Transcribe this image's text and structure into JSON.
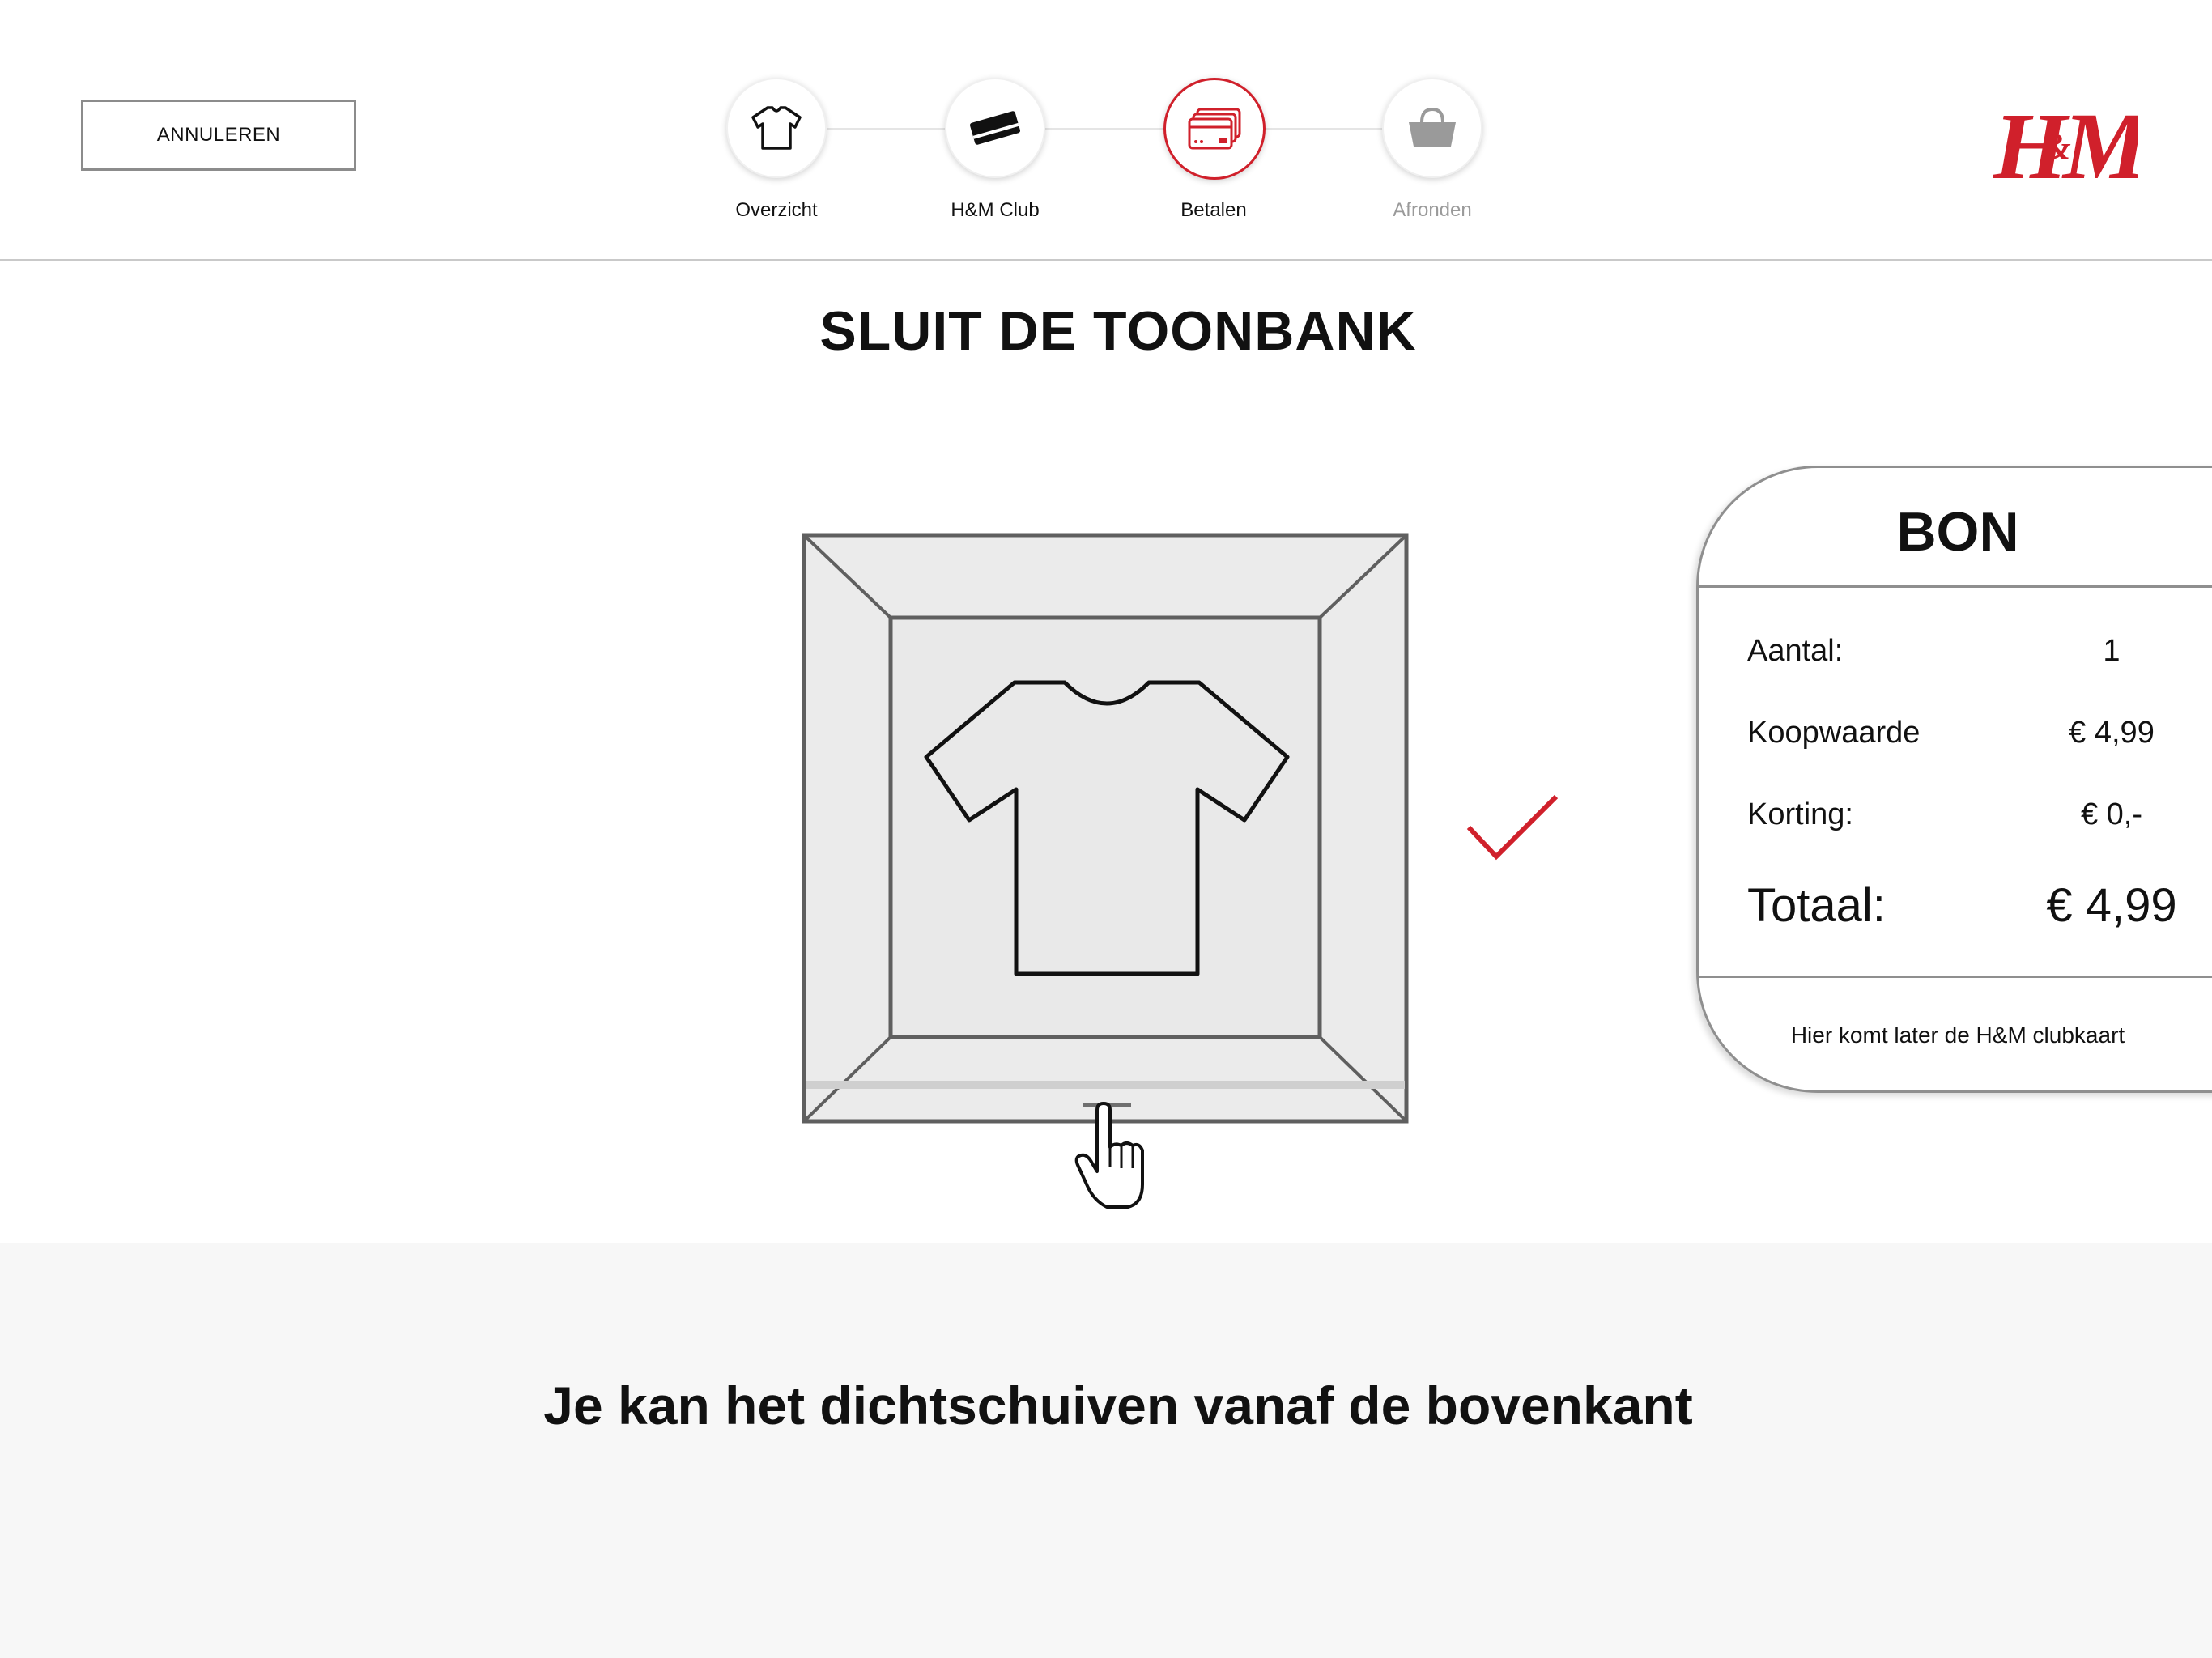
{
  "header": {
    "cancel_label": "ANNULEREN",
    "brand": "H&M",
    "brand_color": "#d0202b"
  },
  "stepper": {
    "steps": [
      {
        "label": "Overzicht",
        "icon": "tshirt-icon",
        "state": "done"
      },
      {
        "label": "H&M Club",
        "icon": "card-icon",
        "state": "done"
      },
      {
        "label": "Betalen",
        "icon": "payment-cards-icon",
        "state": "active"
      },
      {
        "label": "Afronden",
        "icon": "basket-icon",
        "state": "upcoming"
      }
    ],
    "active_color": "#d0202b",
    "muted_color": "#9a9a9a"
  },
  "main": {
    "title": "SLUIT DE TOONBANK",
    "illustration_icons": [
      "counter-illustration",
      "tshirt-icon",
      "pointing-hand-icon",
      "checkmark-icon"
    ],
    "checkmark_color": "#d0202b"
  },
  "receipt": {
    "title": "BON",
    "rows": [
      {
        "label": "Aantal:",
        "value": "1"
      },
      {
        "label": "Koopwaarde",
        "value": "€ 4,99"
      },
      {
        "label": "Korting:",
        "value": "€ 0,-"
      }
    ],
    "total": {
      "label": "Totaal:",
      "value": "€ 4,99"
    },
    "note": "Hier komt later de H&M clubkaart"
  },
  "footer": {
    "instruction": "Je kan het dichtschuiven vanaf de bovenkant"
  }
}
